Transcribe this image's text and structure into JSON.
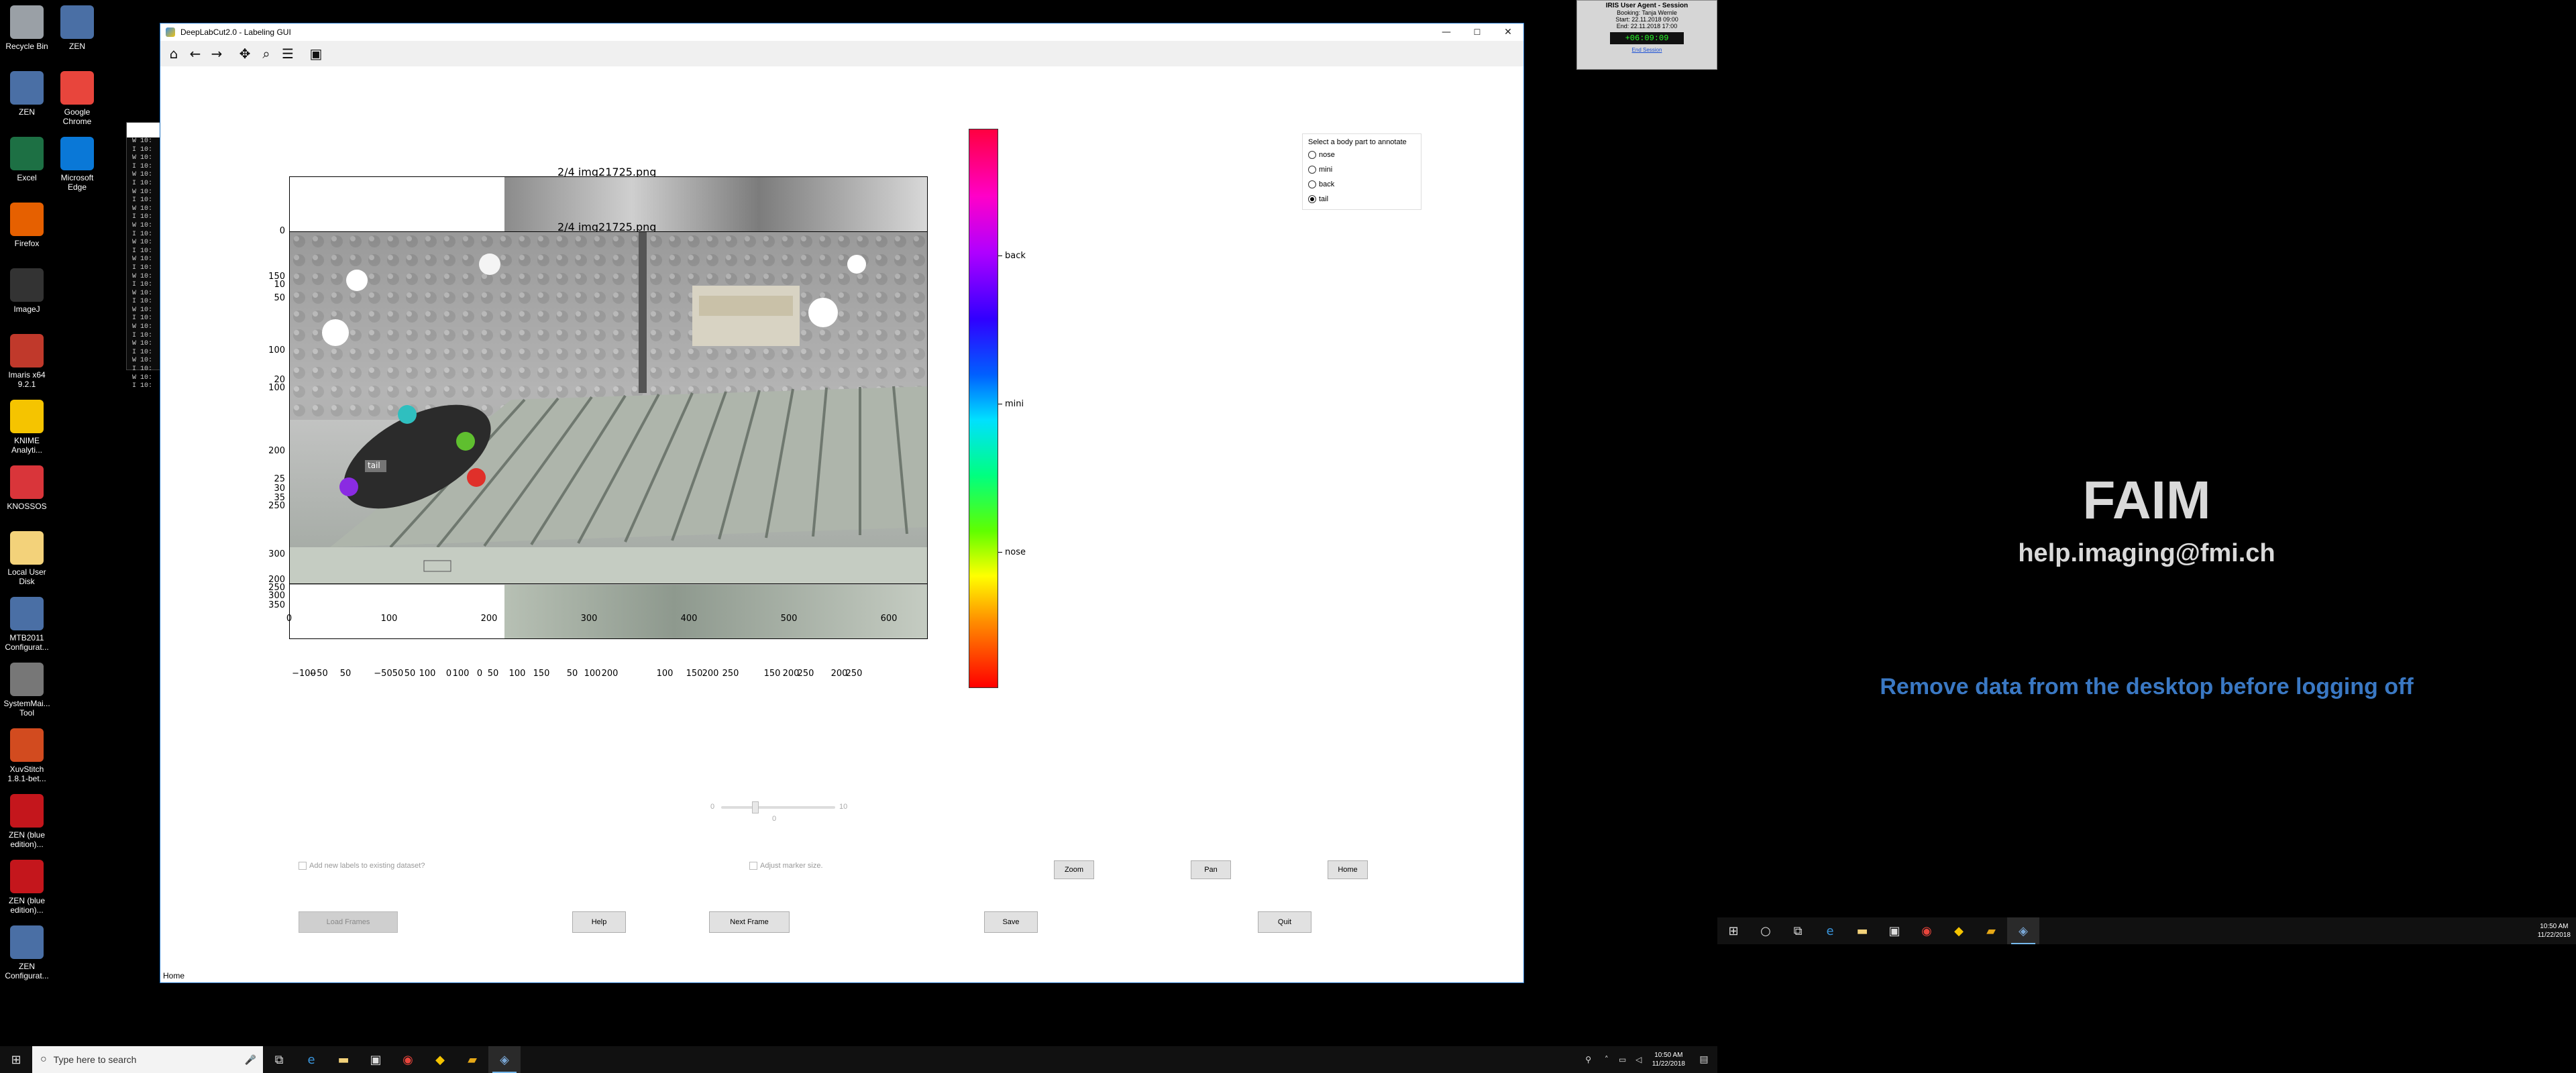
{
  "desktop_icons": [
    {
      "label": "Recycle Bin",
      "icon": "recycle-bin-icon",
      "color": "#9aa0a6"
    },
    {
      "label": "ZEN",
      "icon": "zen-icon",
      "color": "#4a6fa5"
    },
    {
      "label": "ZEN",
      "icon": "zen-icon",
      "color": "#4a6fa5"
    },
    {
      "label": "Google\nChrome",
      "icon": "chrome-icon",
      "color": "#e8453c"
    },
    {
      "label": "Excel",
      "icon": "excel-icon",
      "color": "#1d7044"
    },
    {
      "label": "Microsoft\nEdge",
      "icon": "edge-icon",
      "color": "#0a78d7"
    },
    {
      "label": "Firefox",
      "icon": "firefox-icon",
      "color": "#e66000"
    },
    {
      "label": "ImageJ",
      "icon": "imagej-icon",
      "color": "#333333"
    },
    {
      "label": "Imaris x64\n9.2.1",
      "icon": "imaris-icon",
      "color": "#c0392b"
    },
    {
      "label": "KNIME\nAnalyti...",
      "icon": "knime-icon",
      "color": "#f5c400"
    },
    {
      "label": "KNOSSOS",
      "icon": "knossos-icon",
      "color": "#d9353a"
    },
    {
      "label": "Local User\nDisk",
      "icon": "folder-icon",
      "color": "#f3d27a"
    },
    {
      "label": "MTB2011\nConfigurat...",
      "icon": "mtb-icon",
      "color": "#4a6fa5"
    },
    {
      "label": "SystemMai...\nTool",
      "icon": "wrench-icon",
      "color": "#777777"
    },
    {
      "label": "XuvStitch\n1.8.1-bet...",
      "icon": "xuvstitch-icon",
      "color": "#d24b1f"
    },
    {
      "label": "ZEN (blue\nedition)...",
      "icon": "pdf-icon",
      "color": "#c4161c"
    },
    {
      "label": "ZEN (blue\nedition)...",
      "icon": "pdf-icon",
      "color": "#c4161c"
    },
    {
      "label": "ZEN\nConfigurat...",
      "icon": "zen-config-icon",
      "color": "#4a6fa5"
    }
  ],
  "console": {
    "lines": [
      "W 10:",
      "I 10:",
      "W 10:",
      "I 10:",
      "W 10:",
      "I 10:",
      "W 10:",
      "I 10:",
      "W 10:",
      "I 10:",
      "W 10:",
      "I 10:",
      "W 10:",
      "I 10:",
      "W 10:",
      "I 10:",
      "W 10:",
      "I 10:",
      "W 10:",
      "I 10:",
      "W 10:",
      "I 10:",
      "W 10:",
      "I 10:",
      "W 10:",
      "I 10:",
      "W 10:",
      "I 10:",
      "W 10:",
      "I 10:"
    ]
  },
  "window": {
    "title": "DeepLabCut2.0 - Labeling GUI",
    "minimize": "—",
    "maximize": "☐",
    "close": "✕",
    "status": "Home"
  },
  "toolbar": [
    {
      "name": "home-icon",
      "glyph": "⌂"
    },
    {
      "name": "back-arrow-icon",
      "glyph": "←"
    },
    {
      "name": "forward-arrow-icon",
      "glyph": "→"
    },
    {
      "name": "pan-icon",
      "glyph": "✥"
    },
    {
      "name": "zoom-icon",
      "glyph": "⌕"
    },
    {
      "name": "configure-subplots-icon",
      "glyph": "☰"
    },
    {
      "name": "save-icon",
      "glyph": "▣"
    }
  ],
  "plot": {
    "back_title": "2/4 img21725.png",
    "front_title": "2/4 img21725.png",
    "y_ticks": [
      "0",
      "150",
      "50",
      "100",
      "200",
      "250",
      "300",
      "350",
      "10",
      "15",
      "50",
      "100",
      "20",
      "25",
      "30",
      "35",
      "200",
      "250",
      "300",
      "350",
      "200",
      "250",
      "300",
      "350"
    ],
    "x_ticks_front": [
      "0",
      "100",
      "200",
      "300",
      "400",
      "500",
      "600"
    ],
    "x_ticks_back_row": [
      "−100",
      "−50",
      "50",
      "−50",
      "50",
      "50",
      "100",
      "0",
      "100",
      "0",
      "50",
      "100",
      "150",
      "50",
      "100",
      "200",
      "100",
      "150",
      "200",
      "250",
      "150",
      "200",
      "250",
      "200",
      "250"
    ],
    "marker_label": "tail"
  },
  "colorbar": {
    "labels": [
      "back",
      "mini",
      "nose"
    ]
  },
  "annotate_box": {
    "title": "Select a body part to annotate",
    "options": [
      "nose",
      "mini",
      "back",
      "tail"
    ],
    "selected": "tail"
  },
  "slider": {
    "min": "0",
    "max": "10",
    "value": "0"
  },
  "checkboxes": {
    "add_labels": "Add new labels to existing dataset?",
    "marker_size": "Adjust marker size."
  },
  "buttons": {
    "zoom": "Zoom",
    "pan": "Pan",
    "home": "Home",
    "load_frames": "Load Frames",
    "help": "Help",
    "next_frame": "Next Frame",
    "save": "Save",
    "quit": "Quit"
  },
  "wallpaper": {
    "brand": "FAIM",
    "email": "help.imaging@fmi.ch",
    "warning": "Remove data from the desktop before logging off"
  },
  "iris": {
    "title": "IRIS User Agent - Session",
    "booking": "Booking: Tanja Wernle",
    "start": "Start: 22.11.2018 09:00",
    "end": "End: 22.11.2018 17:00",
    "clock": "+06:09:09",
    "link": "End Session"
  },
  "taskbar_main": {
    "search_placeholder": "Type here to search",
    "time": "10:50 AM",
    "date": "11/22/2018"
  },
  "taskbar_second": {
    "time": "10:50 AM",
    "date": "11/22/2018"
  },
  "colors": {
    "accent": "#1a6fc1",
    "warning_text": "#3a78c3",
    "marker_cyan": "#2fbfbf",
    "marker_green": "#5fbf2f",
    "marker_red": "#e0302a",
    "marker_purple": "#8a2be2"
  }
}
